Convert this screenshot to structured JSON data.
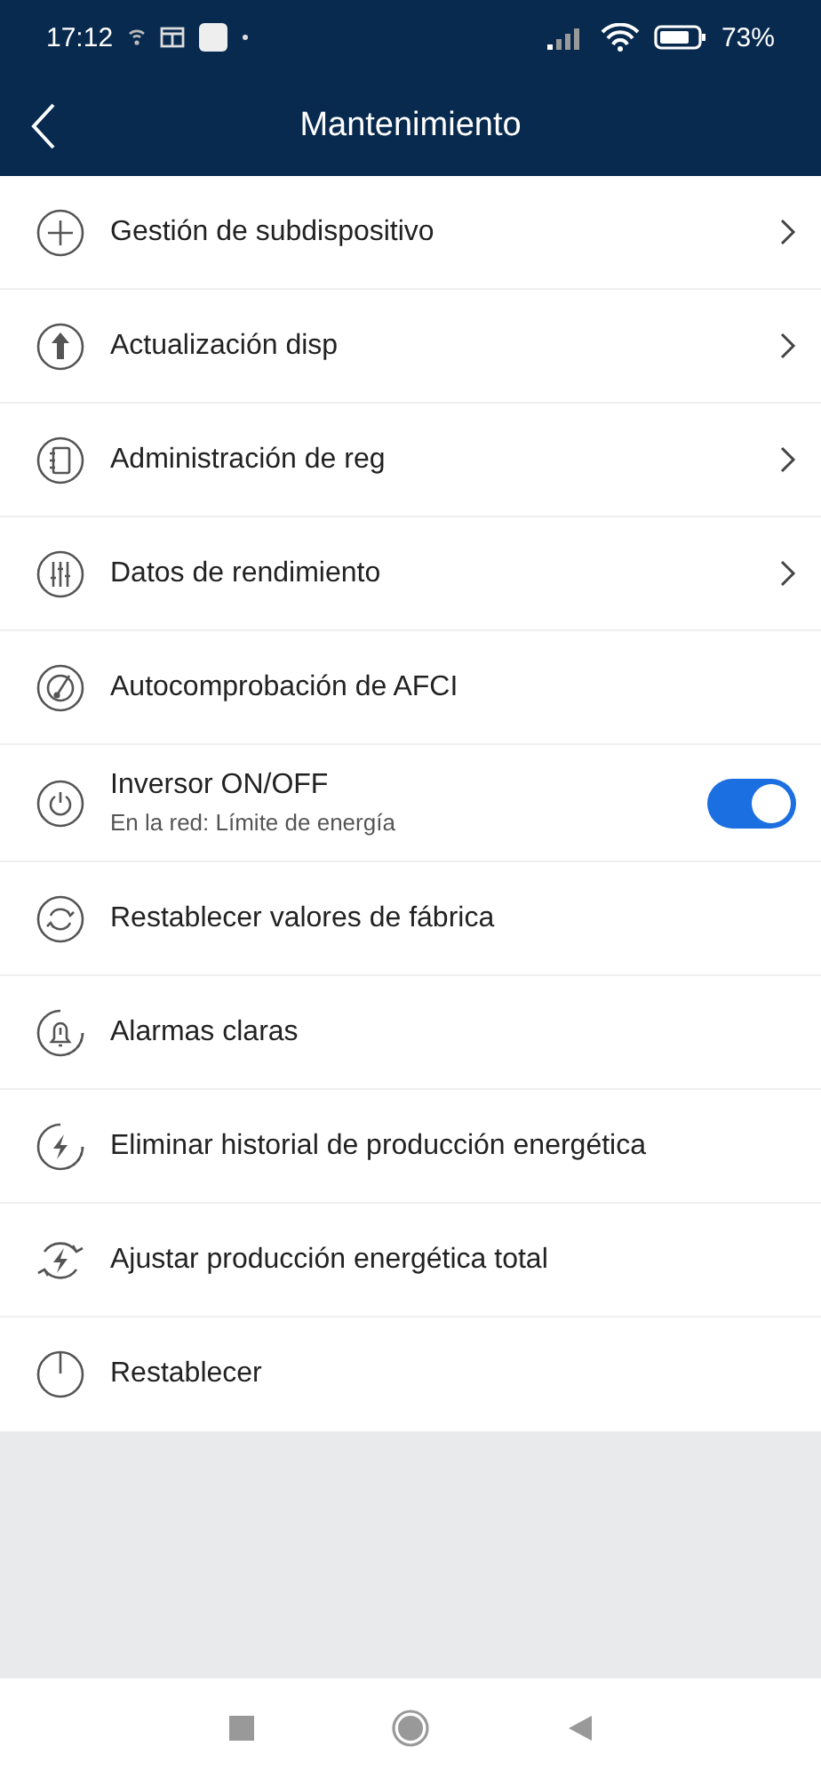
{
  "status_bar": {
    "time": "17:12",
    "battery": "73%"
  },
  "header": {
    "title": "Mantenimiento"
  },
  "items": [
    {
      "kind": "link",
      "label": "Gestión de subdispositivo"
    },
    {
      "kind": "link",
      "label": "Actualización disp"
    },
    {
      "kind": "link",
      "label": "Administración de reg"
    },
    {
      "kind": "link",
      "label": "Datos de rendimiento"
    },
    {
      "kind": "action",
      "label": "Autocomprobación de AFCI"
    },
    {
      "kind": "toggle",
      "label": "Inversor ON/OFF",
      "subtitle": "En la red: Límite de energía",
      "on": true
    },
    {
      "kind": "action",
      "label": "Restablecer valores de fábrica"
    },
    {
      "kind": "action",
      "label": "Alarmas claras"
    },
    {
      "kind": "action",
      "label": "Eliminar historial de producción energética"
    },
    {
      "kind": "action",
      "label": "Ajustar producción energética total"
    },
    {
      "kind": "action",
      "label": "Restablecer"
    }
  ]
}
